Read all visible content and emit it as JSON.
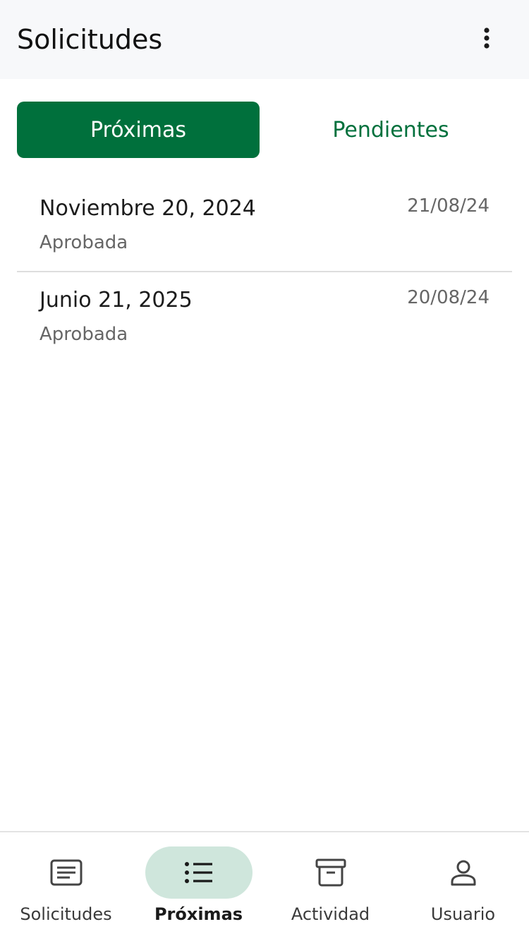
{
  "header": {
    "title": "Solicitudes",
    "menu_icon": "more-vertical-icon"
  },
  "tabs": [
    {
      "label": "Próximas",
      "active": true
    },
    {
      "label": "Pendientes",
      "active": false
    }
  ],
  "requests": [
    {
      "title": "Noviembre 20, 2024",
      "status": "Aprobada",
      "date": "21/08/24"
    },
    {
      "title": "Junio 21, 2025",
      "status": "Aprobada",
      "date": "20/08/24"
    }
  ],
  "bottom_nav": [
    {
      "label": "Solicitudes",
      "icon": "document-icon",
      "selected": false
    },
    {
      "label": "Próximas",
      "icon": "list-icon",
      "selected": true
    },
    {
      "label": "Actividad",
      "icon": "archive-icon",
      "selected": false
    },
    {
      "label": "Usuario",
      "icon": "user-icon",
      "selected": false
    }
  ],
  "colors": {
    "accent": "#00703c",
    "nav_selected_bg": "#cfe6dc",
    "app_bar_bg": "#f7f8fa"
  }
}
